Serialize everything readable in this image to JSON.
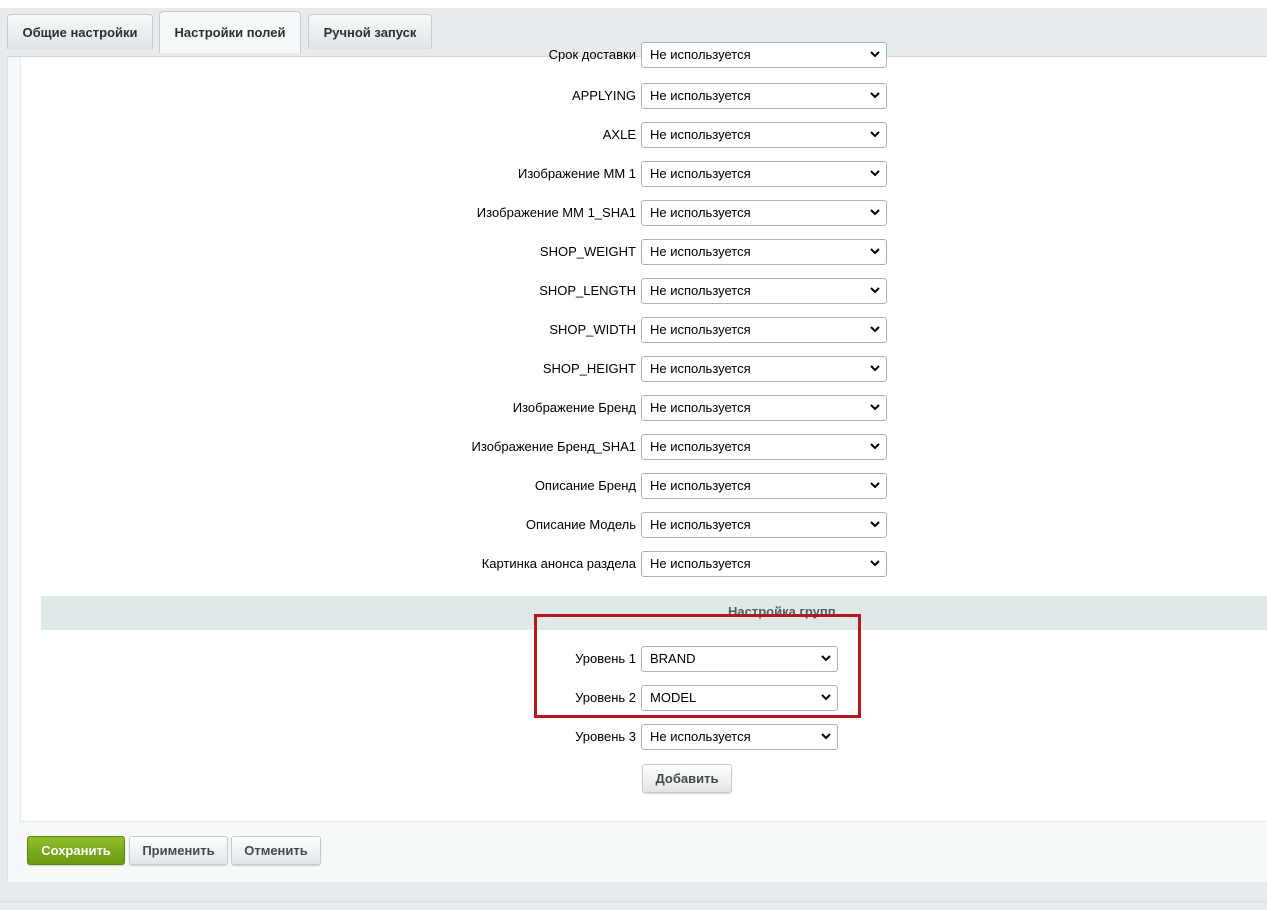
{
  "tabs": [
    {
      "label": "Общие настройки",
      "active": false
    },
    {
      "label": "Настройки полей",
      "active": true
    },
    {
      "label": "Ручной запуск",
      "active": false
    }
  ],
  "fields": {
    "partial_row": {
      "label": "Срок доставки",
      "value": "Не используется"
    },
    "rows": [
      {
        "label": "APPLYING",
        "value": "Не используется"
      },
      {
        "label": "AXLE",
        "value": "Не используется"
      },
      {
        "label": "Изображение ММ 1",
        "value": "Не используется"
      },
      {
        "label": "Изображение ММ 1_SHA1",
        "value": "Не используется"
      },
      {
        "label": "SHOP_WEIGHT",
        "value": "Не используется"
      },
      {
        "label": "SHOP_LENGTH",
        "value": "Не используется"
      },
      {
        "label": "SHOP_WIDTH",
        "value": "Не используется"
      },
      {
        "label": "SHOP_HEIGHT",
        "value": "Не используется"
      },
      {
        "label": "Изображение Бренд",
        "value": "Не используется"
      },
      {
        "label": "Изображение Бренд_SHA1",
        "value": "Не используется"
      },
      {
        "label": "Описание Бренд",
        "value": "Не используется"
      },
      {
        "label": "Описание Модель",
        "value": "Не используется"
      },
      {
        "label": "Картинка анонса раздела",
        "value": "Не используется"
      }
    ]
  },
  "groups": {
    "title": "Настройка групп",
    "levels": [
      {
        "label": "Уровень 1",
        "value": "BRAND"
      },
      {
        "label": "Уровень 2",
        "value": "MODEL"
      },
      {
        "label": "Уровень 3",
        "value": "Не используется"
      }
    ],
    "add_label": "Добавить"
  },
  "footer": {
    "save_label": "Сохранить",
    "apply_label": "Применить",
    "cancel_label": "Отменить"
  },
  "colors": {
    "highlight": "#b7181c",
    "save_button": "#7aa91c"
  }
}
